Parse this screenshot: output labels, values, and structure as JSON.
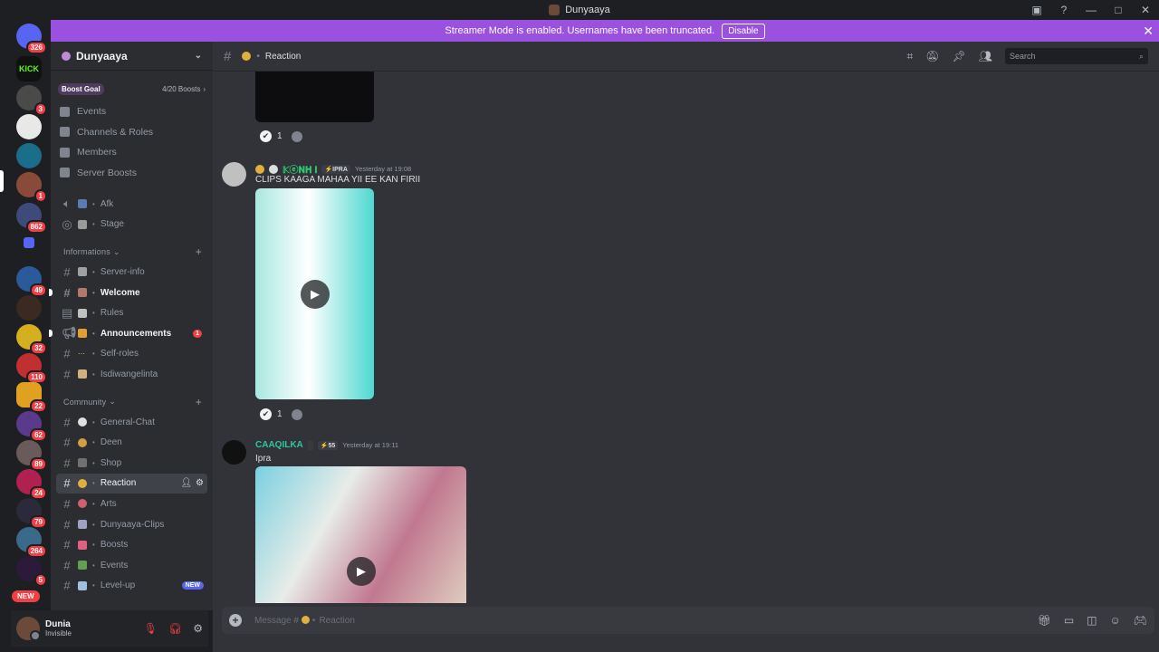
{
  "window": {
    "title": "Dunyaaya",
    "controls": [
      "?",
      "—",
      "□",
      "✕"
    ]
  },
  "banner": {
    "text": "Streamer Mode is enabled. Usernames have been truncated.",
    "button": "Disable"
  },
  "rail": {
    "servers": [
      {
        "label": "",
        "badge": "326"
      },
      {
        "label": "KICK",
        "badge": ""
      },
      {
        "label": "",
        "badge": "3"
      },
      {
        "label": "",
        "badge": ""
      },
      {
        "label": "",
        "badge": ""
      },
      {
        "label": "",
        "badge": "1"
      },
      {
        "label": "",
        "badge": "862"
      },
      {
        "label": "",
        "badge": ""
      },
      {
        "label": "",
        "badge": "49"
      },
      {
        "label": "",
        "badge": ""
      },
      {
        "label": "",
        "badge": "32"
      },
      {
        "label": "",
        "badge": "110"
      },
      {
        "label": "",
        "badge": "22"
      },
      {
        "label": "",
        "badge": "62"
      },
      {
        "label": "",
        "badge": "89"
      },
      {
        "label": "",
        "badge": "24"
      },
      {
        "label": "",
        "badge": "79"
      },
      {
        "label": "",
        "badge": "264"
      },
      {
        "label": "",
        "badge": "5"
      }
    ],
    "new_label": "NEW"
  },
  "server": {
    "name": "Dunyaaya",
    "boost_goal": "Boost Goal",
    "boost_count": "4/20 Boosts"
  },
  "menu": [
    "Events",
    "Channels & Roles",
    "Members",
    "Server Boosts"
  ],
  "voice": [
    "Afk",
    "Stage"
  ],
  "categories": {
    "info": "Informations",
    "community": "Community"
  },
  "info_channels": [
    {
      "name": "Server-info",
      "unread": false,
      "mention": ""
    },
    {
      "name": "Welcome",
      "unread": true,
      "mention": ""
    },
    {
      "name": "Rules",
      "unread": false,
      "mention": ""
    },
    {
      "name": "Announcements",
      "unread": true,
      "mention": "1"
    },
    {
      "name": "Self-roles",
      "unread": false,
      "mention": ""
    },
    {
      "name": "Isdiwangelinta",
      "unread": false,
      "mention": ""
    }
  ],
  "community_channels": [
    "General-Chat",
    "Deen",
    "Shop",
    "Reaction",
    "Arts",
    "Dunyaaya-Clips",
    "Boosts",
    "Events",
    "Level-up"
  ],
  "new_tag": "NEW",
  "user": {
    "name": "Dunia",
    "status": "Invisible"
  },
  "header": {
    "channel": "Reaction",
    "search_placeholder": "Search"
  },
  "messages": [
    {
      "author": "",
      "reactions": {
        "count": "1"
      }
    },
    {
      "author": "𝕂ⓔ𝐍𝐇 𝐈",
      "role": "IPRA",
      "time": "Yesterday at 19:08",
      "text": "CLIPS KAAGA MAHAA YII EE KAN FIRII",
      "reactions": {
        "count": "1"
      },
      "name_color": "#2dc770"
    },
    {
      "author": "CAAQILKA",
      "role": "55",
      "time": "Yesterday at 19:11",
      "text": "Ipra",
      "name_color": "#2dc7a0"
    }
  ],
  "composer": {
    "placeholder": "Message #",
    "channel": "Reaction"
  }
}
